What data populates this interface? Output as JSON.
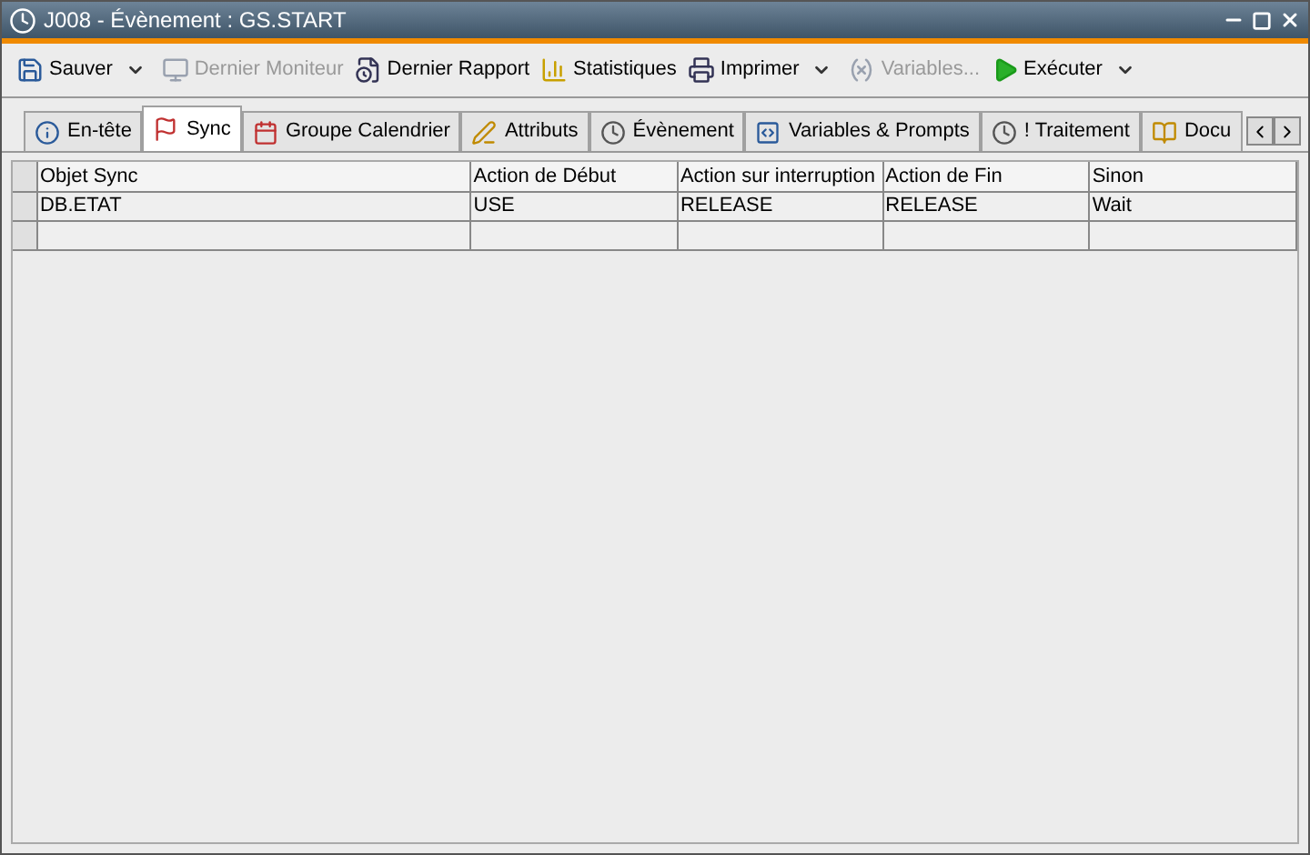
{
  "window": {
    "title": "J008 - Évènement : GS.START"
  },
  "toolbar": [
    {
      "label": "Sauver",
      "kind": "save",
      "disabled": false,
      "dropdown": true
    },
    {
      "label": "Dernier Moniteur",
      "kind": "monitor",
      "disabled": true,
      "dropdown": false
    },
    {
      "label": "Dernier Rapport",
      "kind": "report",
      "disabled": false,
      "dropdown": false
    },
    {
      "label": "Statistiques",
      "kind": "stats",
      "disabled": false,
      "dropdown": false
    },
    {
      "label": "Imprimer",
      "kind": "print",
      "disabled": false,
      "dropdown": true
    },
    {
      "label": "Variables...",
      "kind": "variables",
      "disabled": true,
      "dropdown": false
    },
    {
      "label": "Exécuter",
      "kind": "run",
      "disabled": false,
      "dropdown": true
    }
  ],
  "tabs": [
    {
      "label": "En-tête",
      "kind": "info",
      "selected": false
    },
    {
      "label": "Sync",
      "kind": "sync",
      "selected": true
    },
    {
      "label": "Groupe Calendrier",
      "kind": "calendar",
      "selected": false
    },
    {
      "label": "Attributs",
      "kind": "edit",
      "selected": false
    },
    {
      "label": "Évènement",
      "kind": "clock",
      "selected": false
    },
    {
      "label": "Variables & Prompts",
      "kind": "vars",
      "selected": false
    },
    {
      "label": "! Traitement",
      "kind": "clock",
      "selected": false
    },
    {
      "label": "Docu",
      "kind": "doc",
      "selected": false
    }
  ],
  "table": {
    "columns": [
      "Objet Sync",
      "Action de Début",
      "Action sur interruption",
      "Action de Fin",
      "Sinon"
    ],
    "rows": [
      {
        "cells": [
          "DB.ETAT",
          "USE",
          "RELEASE",
          "RELEASE",
          "Wait"
        ]
      }
    ]
  }
}
